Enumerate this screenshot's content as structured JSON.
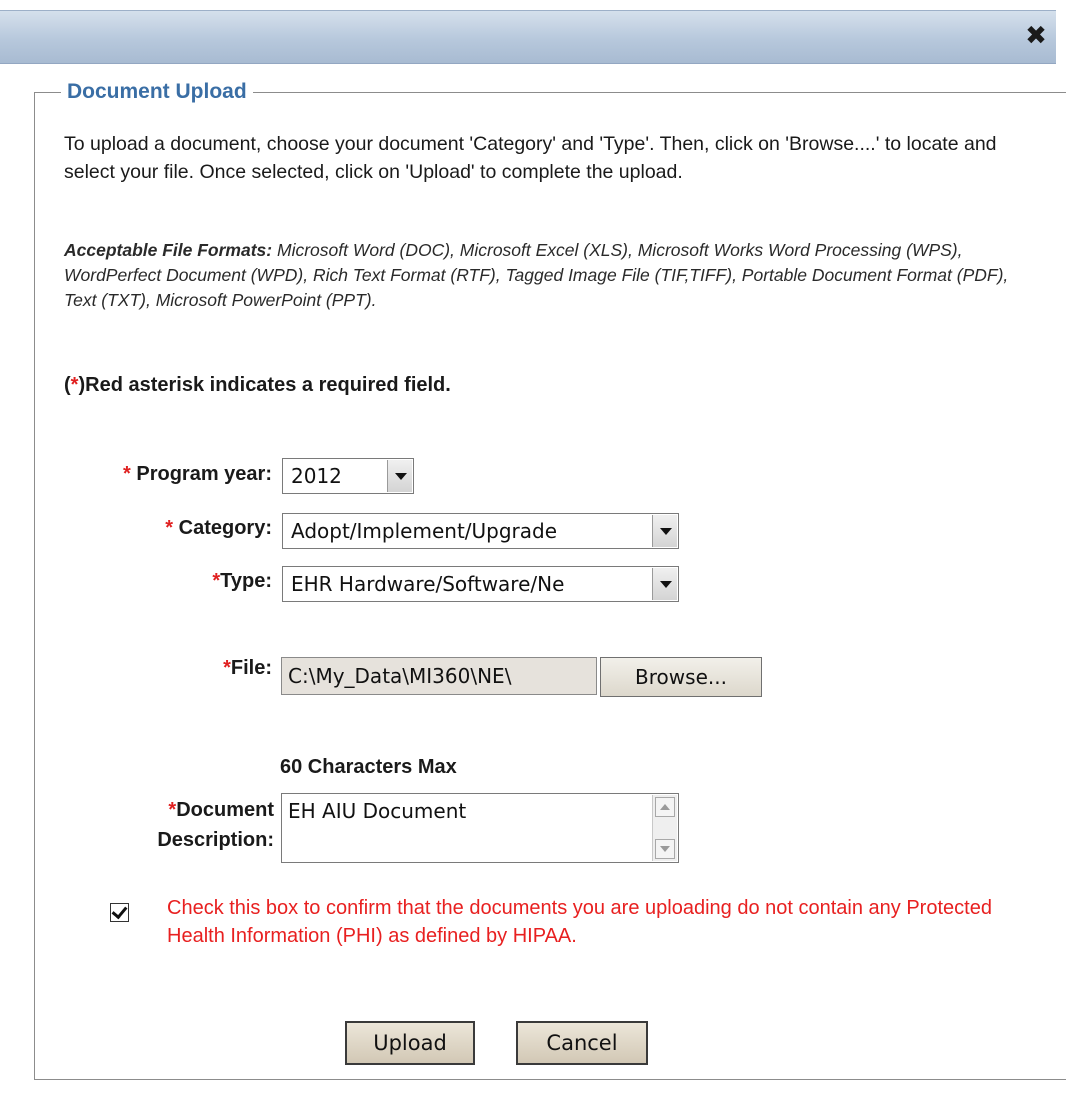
{
  "dialog": {
    "close_glyph": "✖"
  },
  "upload": {
    "legend": "Document Upload",
    "intro": "To upload a document, choose your document 'Category' and 'Type'. Then, click on 'Browse....' to locate and select your file. Once selected, click on 'Upload' to complete the upload.",
    "formats_label": "Acceptable File Formats:",
    "formats_list": " Microsoft Word (DOC), Microsoft Excel (XLS), Microsoft Works Word Processing (WPS), WordPerfect Document (WPD), Rich Text Format (RTF), Tagged Image File (TIF,TIFF), Portable Document Format (PDF), Text (TXT), Microsoft PowerPoint (PPT).",
    "required_open": "(",
    "required_star": "*",
    "required_rest": ")Red asterisk indicates a required field."
  },
  "form": {
    "asterisk": "*",
    "program_year_label": "Program year:",
    "program_year_value": "2012",
    "category_label": "Category:",
    "category_value": "Adopt/Implement/Upgrade",
    "type_label": "Type:",
    "type_value": "EHR Hardware/Software/Ne",
    "file_label": "File:",
    "file_value": "C:\\My_Data\\MI360\\NE\\",
    "browse_label": "Browse...",
    "max_note": "60 Characters Max",
    "description_label_1": "Document",
    "description_label_2": "Description:",
    "description_value": "EH AIU Document",
    "phi_checked": true,
    "phi_text": "Check this box to confirm that the documents you are uploading do not contain any Protected Health Information (PHI) as defined by HIPAA."
  },
  "actions": {
    "upload_label": "Upload",
    "cancel_label": "Cancel"
  },
  "colors": {
    "legend": "#3a6ea5",
    "required": "#e02020",
    "titlebar": "#b7c8dc"
  }
}
